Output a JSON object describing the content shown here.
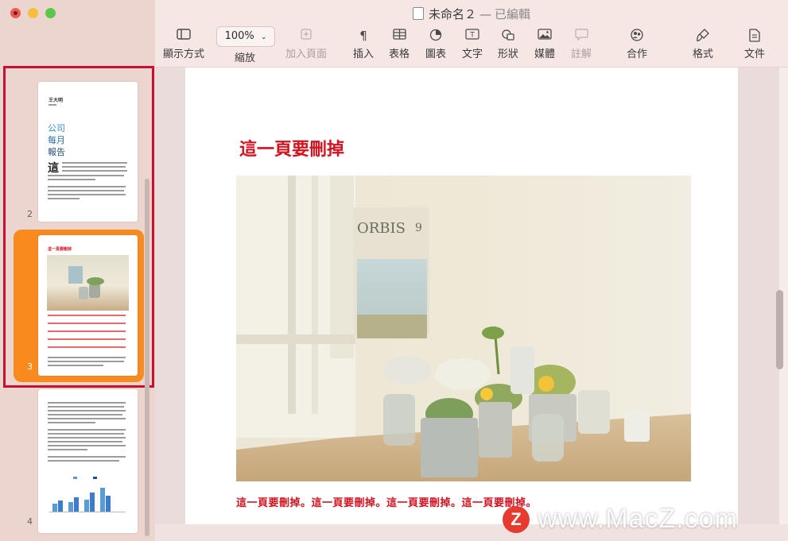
{
  "window": {
    "title": "未命名２",
    "separator": "—",
    "status": "已編輯"
  },
  "toolbar": {
    "view_label": "顯示方式",
    "zoom_value": "100%",
    "zoom_label": "縮放",
    "add_page_label": "加入頁面",
    "insert_label": "插入",
    "table_label": "表格",
    "chart_label": "圖表",
    "text_label": "文字",
    "shape_label": "形狀",
    "media_label": "媒體",
    "comment_label": "註解",
    "collaborate_label": "合作",
    "format_label": "格式",
    "document_label": "文件"
  },
  "sidebar": {
    "pages": [
      {
        "number": "2",
        "heading_small": "王大明",
        "title_lines": [
          "公司",
          "每月",
          "報告"
        ],
        "drop_cap": "這"
      },
      {
        "number": "3",
        "heading": "這一頁要刪掉",
        "selected": true
      },
      {
        "number": "4"
      }
    ]
  },
  "document": {
    "page_title": "這一頁要刪掉",
    "caption": "這一頁要刪掉。這一頁要刪掉。這一頁要刪掉。這一頁要刪掉。",
    "photo": {
      "brand_text": "ORBIS",
      "issue_number": "9"
    }
  },
  "watermark": {
    "badge": "Z",
    "text": "www.MacZ.com"
  },
  "colors": {
    "accent_red": "#d4111e",
    "selection_orange": "#f98a1e",
    "highlight_red": "#c8102e"
  }
}
